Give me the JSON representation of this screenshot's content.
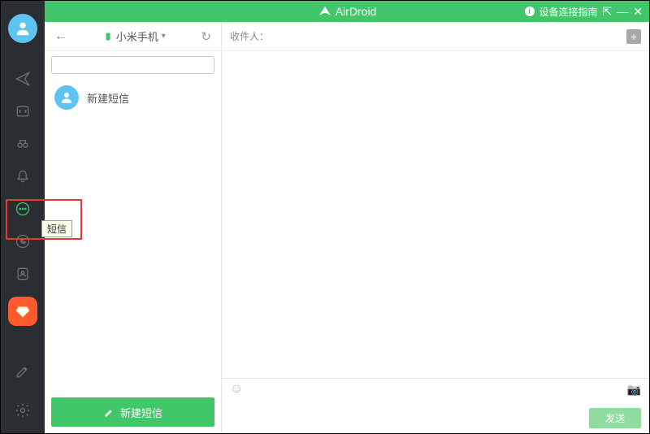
{
  "titlebar": {
    "app_name": "AirDroid",
    "connect_guide": "设备连接指南"
  },
  "sidebar": {
    "tooltip_sms": "短信"
  },
  "list": {
    "device_name": "小米手机",
    "search_placeholder": "",
    "thread_new_label": "新建短信",
    "compose_button": "新建短信"
  },
  "msg": {
    "recipient_label": "收件人：",
    "send_button": "发送"
  }
}
